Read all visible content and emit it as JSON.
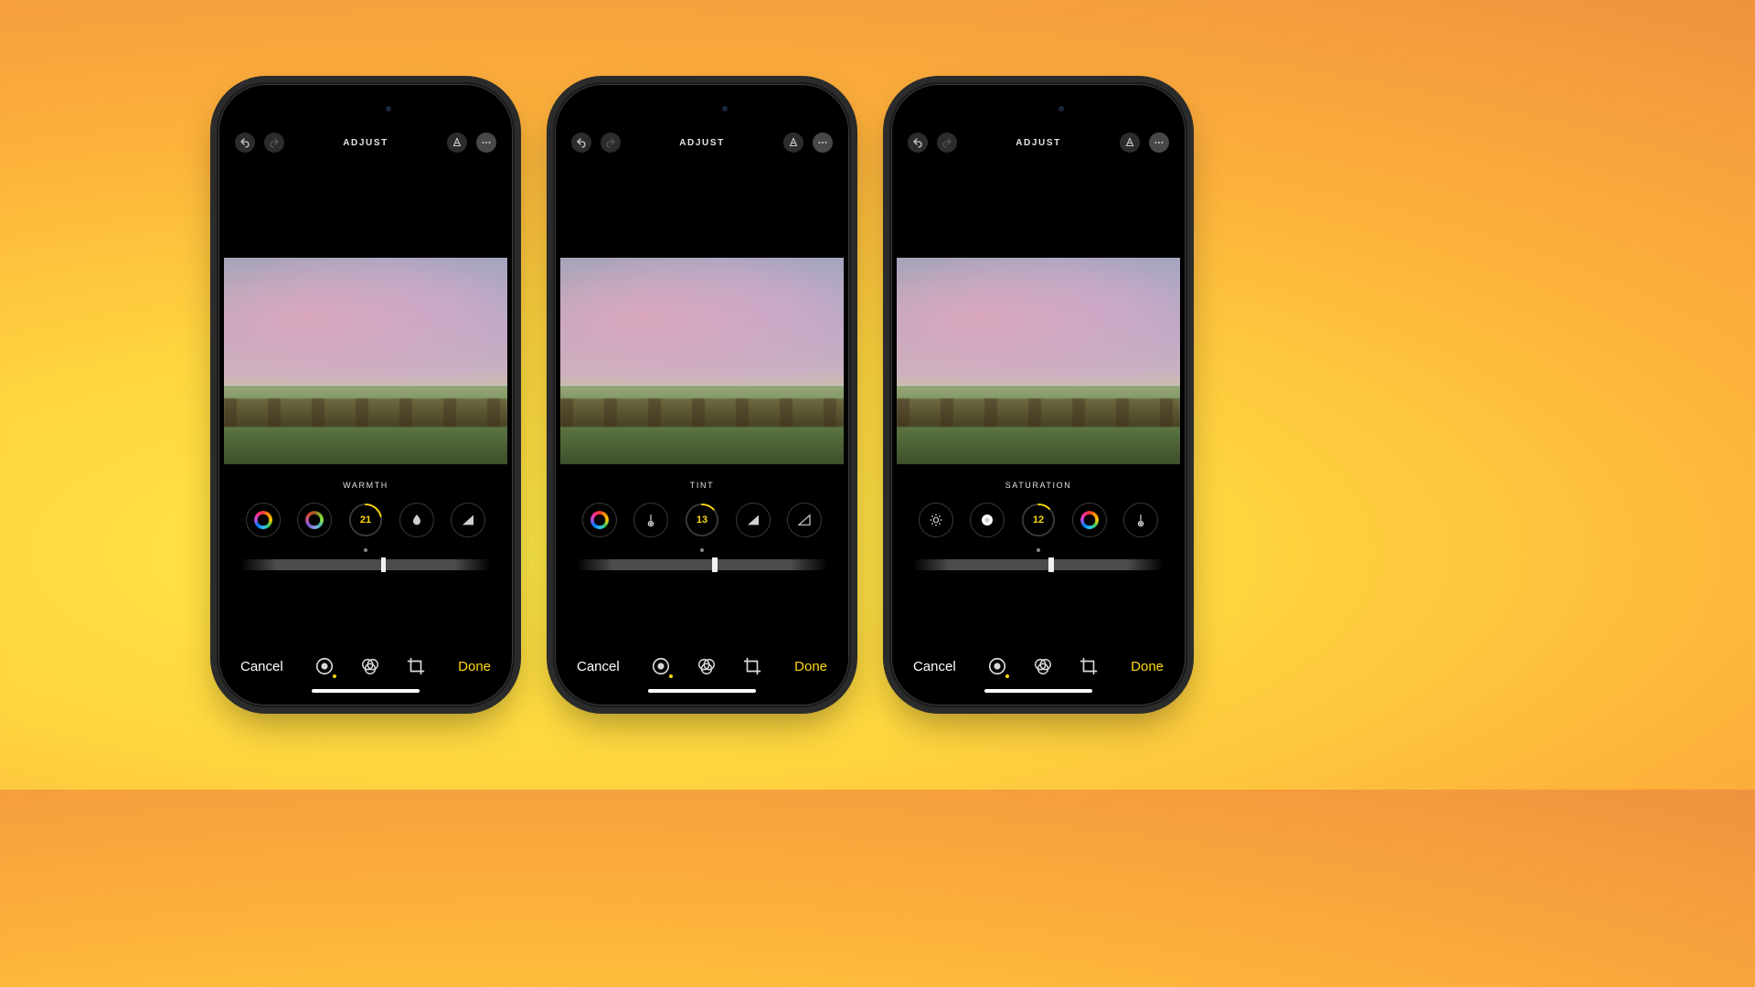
{
  "screen_title": "ADJUST",
  "phones": [
    {
      "param_label": "WARMTH",
      "value": "21",
      "slider_offset_pct": 56,
      "tools": [
        "color-balance-icon",
        "hue-icon",
        "value",
        "blackpoint-icon",
        "contrast-icon"
      ]
    },
    {
      "param_label": "TINT",
      "value": "13",
      "slider_offset_pct": 54,
      "tools": [
        "color-balance-icon",
        "warmth-icon",
        "value",
        "contrast-icon",
        "shadows-icon"
      ]
    },
    {
      "param_label": "SATURATION",
      "value": "12",
      "slider_offset_pct": 54,
      "tools": [
        "brightness-icon",
        "vignette-icon",
        "value",
        "color-balance-icon",
        "warmth-icon"
      ]
    }
  ],
  "buttons": {
    "cancel": "Cancel",
    "done": "Done"
  },
  "colors": {
    "accent": "#ffd60a"
  }
}
